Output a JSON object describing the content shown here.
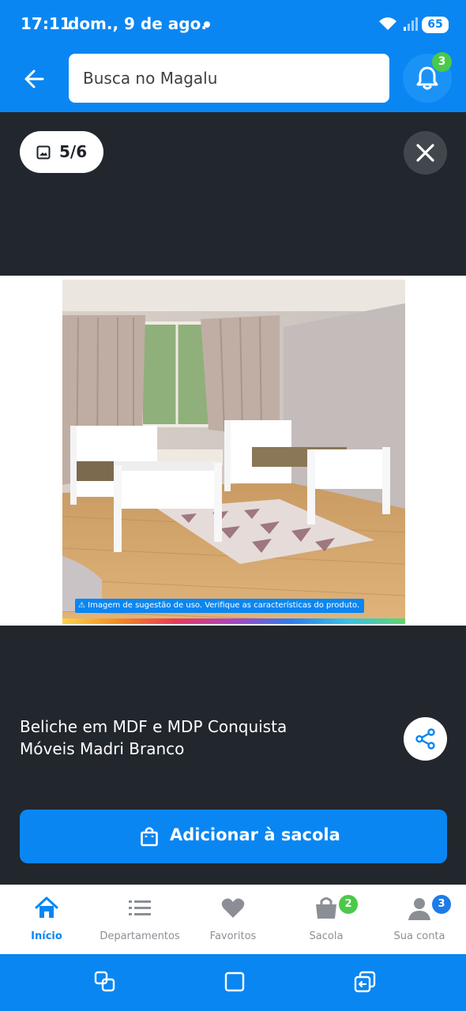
{
  "status_bar": {
    "time": "17:11",
    "date": "dom., 9 de ago.",
    "battery": "65"
  },
  "header": {
    "search_placeholder": "Busca no Magalu",
    "notification_count": "3"
  },
  "gallery": {
    "counter": "5/6",
    "disclaimer": "Imagem de sugestão de uso. Verifique as características do produto."
  },
  "product": {
    "title_line1": "Beliche em MDF e MDP Conquista",
    "title_line2": "Móveis Madri Branco"
  },
  "cta": {
    "add_label": "Adicionar à sacola"
  },
  "bottom_nav": {
    "items": [
      {
        "label": "Início",
        "icon": "home-icon",
        "active": true
      },
      {
        "label": "Departamentos",
        "icon": "list-icon"
      },
      {
        "label": "Favoritos",
        "icon": "heart-icon"
      },
      {
        "label": "Sacola",
        "icon": "bag-icon",
        "badge": "2"
      },
      {
        "label": "Sua conta",
        "icon": "user-icon",
        "badge": "3"
      }
    ]
  },
  "colors": {
    "brand_blue": "#0a86f2",
    "dark_bg": "#22272e",
    "badge_green": "#4bc94a",
    "badge_blue": "#1e7be8"
  }
}
